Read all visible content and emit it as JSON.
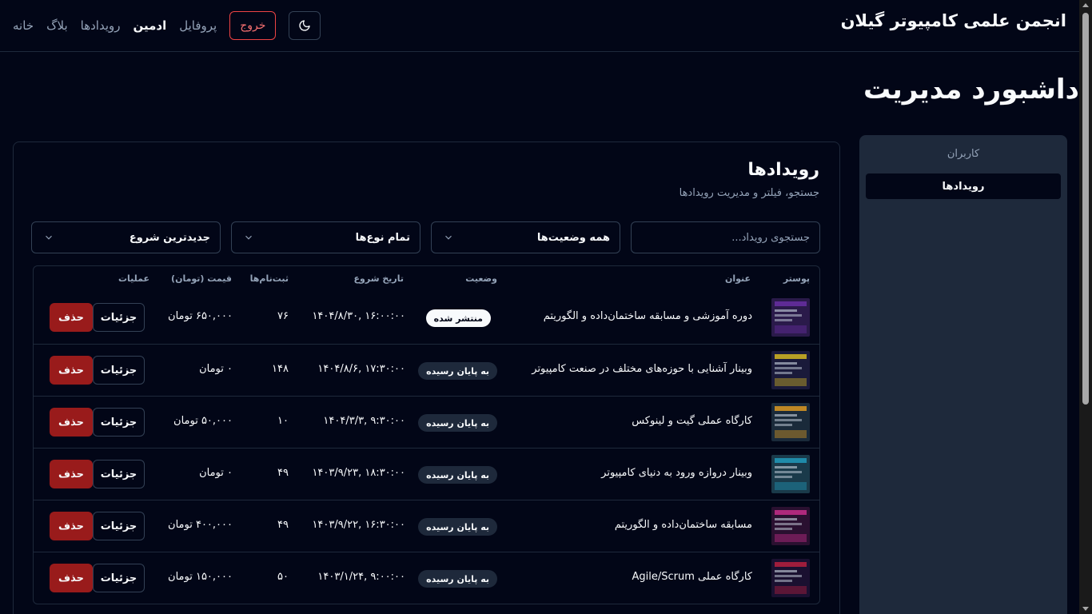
{
  "header": {
    "brand": "انجمن علمی کامپیوتر گیلان",
    "nav": {
      "home": "خانه",
      "blog": "بلاگ",
      "events": "رویدادها",
      "admin": "ادمین",
      "profile": "پروفایل",
      "logout": "خروج"
    },
    "theme_icon": "moon-icon"
  },
  "page": {
    "title": "داشبورد مدیریت"
  },
  "sidebar": {
    "items": [
      {
        "label": "کاربران",
        "active": false
      },
      {
        "label": "رویدادها",
        "active": true
      }
    ]
  },
  "card": {
    "title": "رویدادها",
    "subtitle": "جستجو، فیلتر و مدیریت رویدادها",
    "search_placeholder": "جستجوی رویداد...",
    "filters": {
      "status": "همه وضعیت‌ها",
      "type": "تمام نوع‌ها",
      "sort": "جدیدترین شروع"
    }
  },
  "table": {
    "headers": {
      "poster": "پوستر",
      "title": "عنوان",
      "status": "وضعیت",
      "start": "تاریخ شروع",
      "registrations": "ثبت‌نام‌ها",
      "price": "قیمت (تومان)",
      "actions": "عملیات"
    },
    "details_label": "جزئیات",
    "delete_label": "حذف",
    "rows": [
      {
        "title": "دوره آموزشی و مسابقه ساختمان‌داده و الگوریتم",
        "status": "منتشر شده",
        "status_kind": "published",
        "start": "۱۶:۰۰:۰۰ ,۱۴۰۴/۸/۳۰",
        "registrations": "۷۶",
        "price": "۶۵۰,۰۰۰ تومان"
      },
      {
        "title": "وبینار آشنایی با حوزه‌های مختلف در صنعت کامپیوتر",
        "status": "به پایان رسیده",
        "status_kind": "ended",
        "start": "۱۷:۳۰:۰۰ ,۱۴۰۴/۸/۶",
        "registrations": "۱۴۸",
        "price": "۰ تومان"
      },
      {
        "title": "کارگاه عملی گیت و لینوکس",
        "status": "به پایان رسیده",
        "status_kind": "ended",
        "start": "۹:۳۰:۰۰ ,۱۴۰۴/۳/۳",
        "registrations": "۱۰",
        "price": "۵۰,۰۰۰ تومان"
      },
      {
        "title": "وبینار دروازه ورود به دنیای کامپیوتر",
        "status": "به پایان رسیده",
        "status_kind": "ended",
        "start": "۱۸:۳۰:۰۰ ,۱۴۰۳/۹/۲۳",
        "registrations": "۴۹",
        "price": "۰ تومان"
      },
      {
        "title": "مسابقه ساختمان‌داده و الگوریتم",
        "status": "به پایان رسیده",
        "status_kind": "ended",
        "start": "۱۶:۳۰:۰۰ ,۱۴۰۳/۹/۲۲",
        "registrations": "۴۹",
        "price": "۴۰۰,۰۰۰ تومان"
      },
      {
        "title": "کارگاه عملی Agile/Scrum",
        "status": "به پایان رسیده",
        "status_kind": "ended",
        "start": "۹:۰۰:۰۰ ,۱۴۰۳/۱/۲۴",
        "registrations": "۵۰",
        "price": "۱۵۰,۰۰۰ تومان"
      }
    ]
  }
}
